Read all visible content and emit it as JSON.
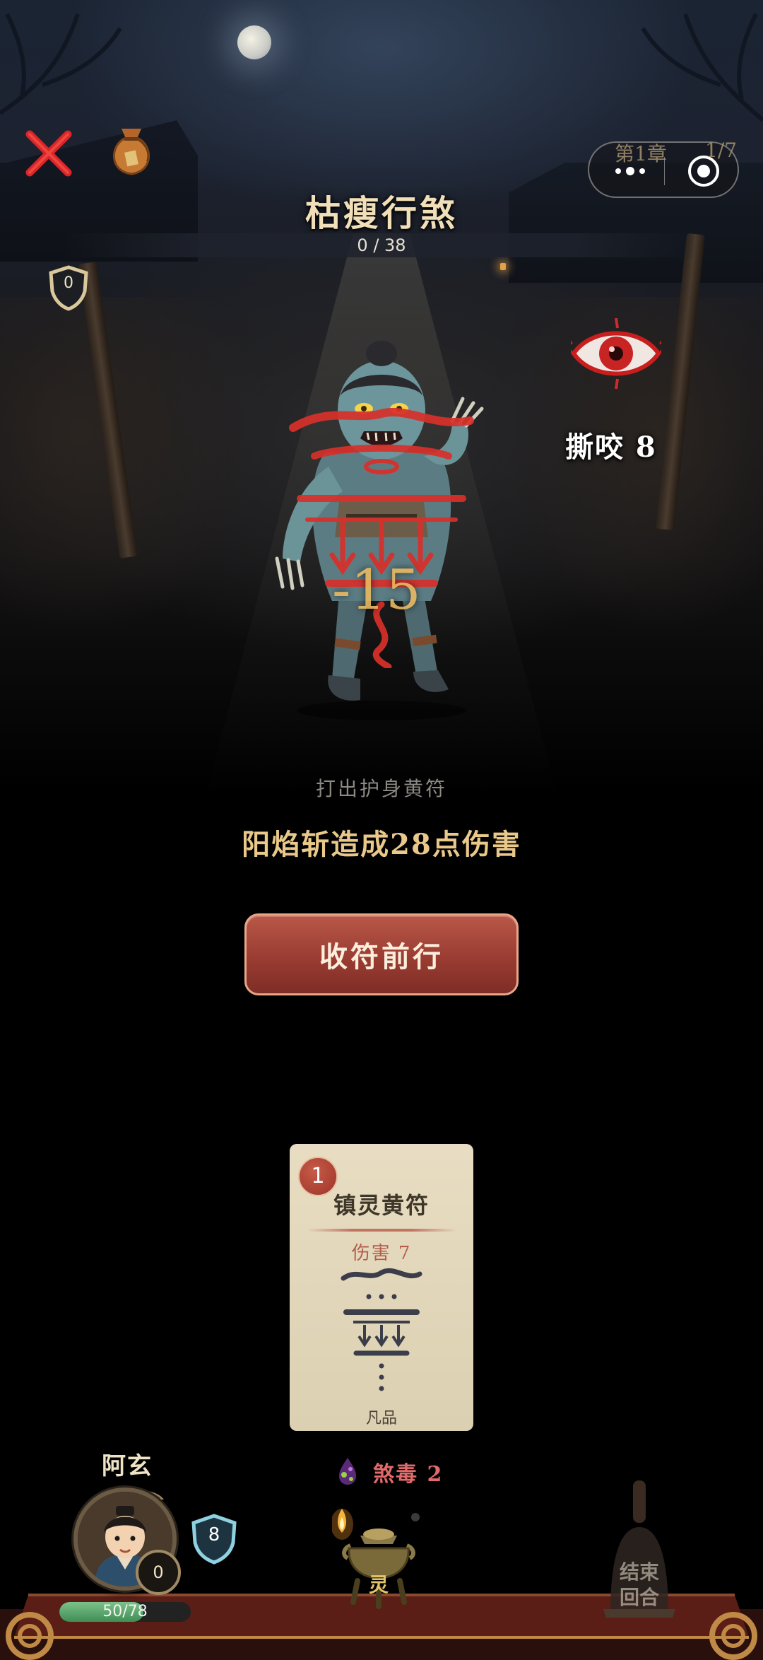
{
  "topbar": {
    "chapter": "第1章",
    "stage_progress": "1/7"
  },
  "enemy": {
    "name": "枯瘦行煞",
    "hp_text": "0 / 38",
    "block": "0",
    "intent": "撕咬 8",
    "damage_popup": "-15"
  },
  "battle_log": {
    "action": "打出护身黄符",
    "result": "阳焰斩造成28点伤害"
  },
  "proceed_button": {
    "label": "收符前行"
  },
  "card": {
    "cost": "1",
    "name": "镇灵黄符",
    "description": "伤害 7",
    "rarity": "凡品"
  },
  "player": {
    "name": "阿玄",
    "block": "0",
    "shield": "8",
    "hp_text": "50/78",
    "hp_fraction": 0.64
  },
  "status_effect": {
    "label": "煞毒 2"
  },
  "energy": {
    "label": "灵"
  },
  "end_turn": {
    "label_line1": "结束",
    "label_line2": "回合"
  },
  "colors": {
    "accent_gold": "#e9c88a",
    "button_red": "#9a3c32",
    "poison_red": "#e26a6a",
    "hp_green": "#5aa86c"
  }
}
